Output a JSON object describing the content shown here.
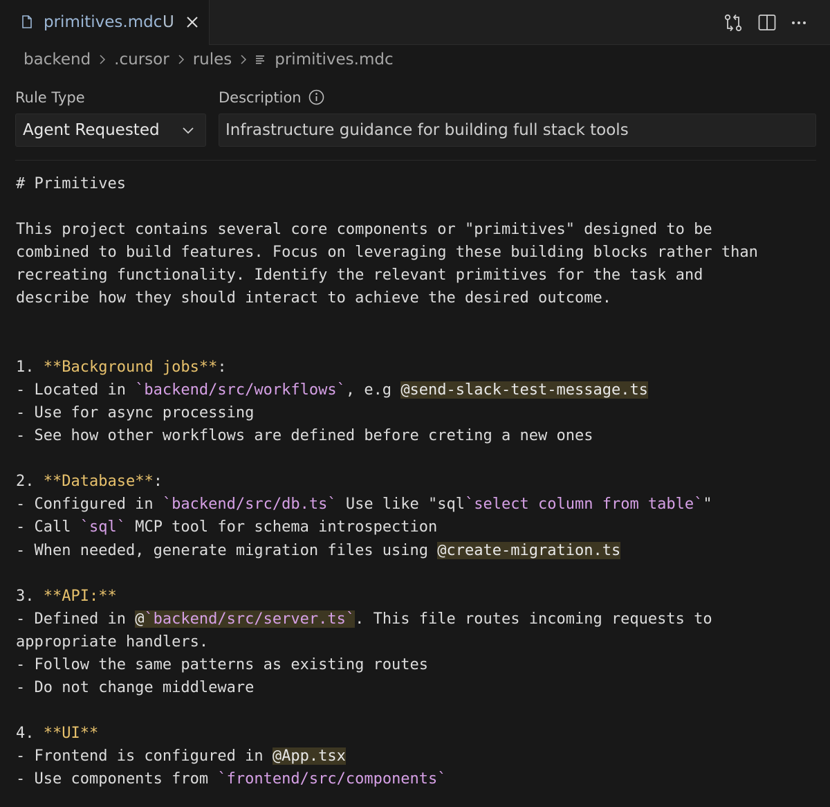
{
  "tab": {
    "title": "primitives.mdc",
    "status": "U"
  },
  "breadcrumb": {
    "items": [
      "backend",
      ".cursor",
      "rules",
      "primitives.mdc"
    ]
  },
  "form": {
    "rule_type_label": "Rule Type",
    "rule_type_value": "Agent Requested",
    "description_label": "Description",
    "description_value": "Infrastructure guidance for building full stack tools"
  },
  "icons": [
    "file-icon",
    "close-icon",
    "compare-changes-icon",
    "split-editor-icon",
    "more-actions-icon",
    "chevron-right-icon",
    "lines-icon",
    "info-icon",
    "chevron-down-icon"
  ],
  "colors": {
    "background": "#181818",
    "bold": "#e7c16c",
    "code": "#d6a0e6",
    "mention_bg": "#3d3722",
    "tab_title": "#9cb7d6"
  },
  "editor": {
    "heading": "# Primitives",
    "intro": [
      "This project contains several core components or \"primitives\" designed to be",
      "combined to build features. Focus on leveraging these building blocks rather than",
      "recreating functionality. Identify the relevant primitives for the task and",
      "describe how they should interact to achieve the desired outcome."
    ],
    "s1": {
      "num": "1. ",
      "title": "**Background jobs**",
      "colon": ":",
      "l1a": "- Located in ",
      "l1code": "`backend/src/workflows`",
      "l1b": ", e.g ",
      "l1mention": "@send-slack-test-message.ts",
      "l2": "- Use for async processing",
      "l3": "- See how other workflows are defined before creting a new ones"
    },
    "s2": {
      "num": "2. ",
      "title": "**Database**",
      "colon": ":",
      "l1a": "- Configured in ",
      "l1code": "`backend/src/db.ts`",
      "l1b": " Use like \"sql",
      "l1code2": "`select column from table`",
      "l1c": "\"",
      "l2a": "- Call ",
      "l2code": "`sql`",
      "l2b": " MCP tool for schema introspection",
      "l3a": "- When needed, generate migration files using ",
      "l3mention": "@create-migration.ts"
    },
    "s3": {
      "num": "3. ",
      "title": "**API:**",
      "l1a": "- Defined in ",
      "l1at": "@",
      "l1code": "`backend/src/server.ts`",
      "l1b": ". This file routes incoming requests to",
      "l1cont": "appropriate handlers.",
      "l2": "- Follow the same patterns as existing routes",
      "l3": "- Do not change middleware"
    },
    "s4": {
      "num": "4. ",
      "title": "**UI**",
      "l1a": "- Frontend is configured in ",
      "l1mention": "@App.tsx",
      "l2a": "- Use components from ",
      "l2code": "`frontend/src/components`"
    }
  }
}
